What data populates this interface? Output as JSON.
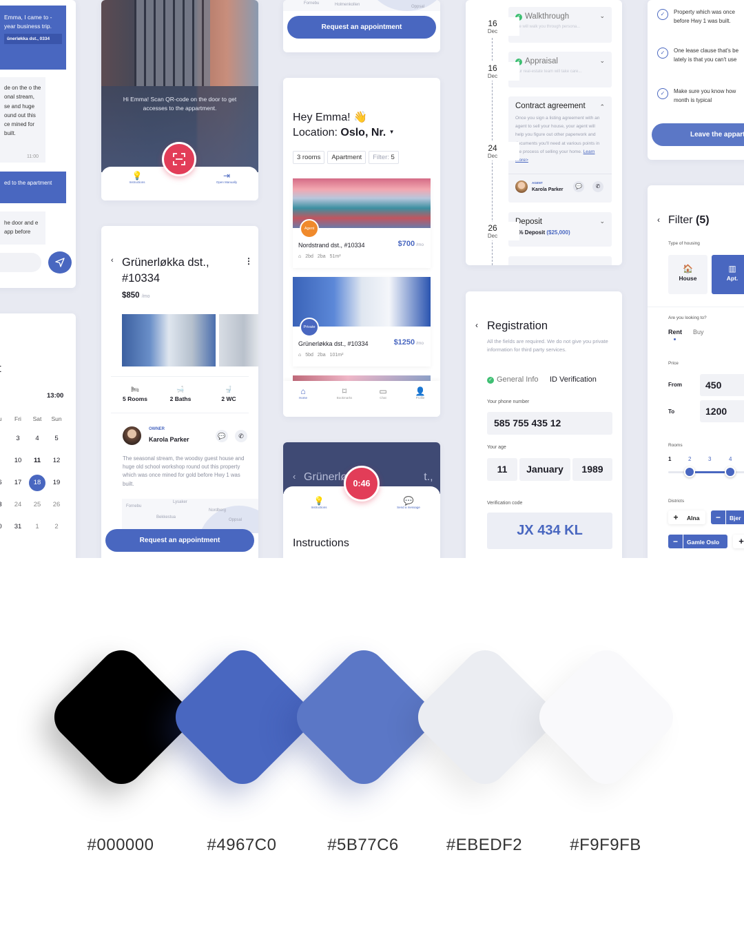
{
  "chat": {
    "msg1": "Emma, I came to -year business trip.",
    "msg1_sub": "ünerløkka dst., 0334",
    "msg2": "de on the o the onal stream, se and huge ound out this ce mined for built.",
    "msg2_time": "11:00",
    "msg3": "ed to the apartment",
    "msg4": "he door and e app before"
  },
  "calendar": {
    "title_fragment": "t",
    "time": "13:00",
    "weekdays": [
      "u",
      "Fri",
      "Sat",
      "Sun"
    ],
    "rows": [
      [
        "",
        "3",
        "4",
        "5"
      ],
      [
        "",
        "10",
        "11",
        "12"
      ],
      [
        "6",
        "17",
        "18",
        "19"
      ],
      [
        "3",
        "24",
        "25",
        "26"
      ],
      [
        "0",
        "31",
        "1",
        "2"
      ]
    ]
  },
  "door": {
    "scan_text": "Hi Emma! Scan QR-code on the door to get accesses to the appartment.",
    "nav_left": "Instructions",
    "nav_right": "Open Manually"
  },
  "listing": {
    "title": "Grünerløkka dst., #10334",
    "price": "$850",
    "per": "/mo",
    "features": [
      {
        "icon": "🛏",
        "label": "5 Rooms"
      },
      {
        "icon": "🛁",
        "label": "2 Baths"
      },
      {
        "icon": "🚽",
        "label": "2 WC"
      }
    ],
    "owner_role": "OWNER",
    "owner_name": "Karola Parker",
    "description": "The seasonal stream, the woodsy guest house and huge old school workshop round out this property which was once mined for gold before Hwy 1 was built.",
    "map_labels": [
      "Lysaker",
      "Bekkestua",
      "Nordberg",
      "Fornebu",
      "Holmenkollen",
      "Oppsal"
    ],
    "cta": "Request an appointment"
  },
  "top_mid": {
    "map_labels": [
      "Fornebu",
      "Holmenkollen",
      "Oppsal"
    ],
    "cta": "Request an appointment"
  },
  "search": {
    "greeting": "Hey Emma! 👋",
    "location_label": "Location:",
    "location_value": "Oslo, Nr.",
    "chips": [
      "3 rooms",
      "Apartment",
      "Filter:",
      "5"
    ],
    "items": [
      {
        "badge": "Agent",
        "name": "Nordstrand dst., #10334",
        "price": "$700",
        "per": "/mo",
        "specs": [
          "2bd",
          "2ba",
          "51m²"
        ]
      },
      {
        "badge": "Private",
        "name": "Grünerløkka dst., #10334",
        "price": "$1250",
        "per": "/mo",
        "specs": [
          "5bd",
          "2ba",
          "101m²"
        ]
      }
    ],
    "nav": [
      "Home",
      "Bookmarks",
      "Chat",
      "Profile"
    ]
  },
  "call": {
    "title_fragment": "Grünerlø                         t.,",
    "timer": "0:46",
    "nav_left": "Instructions",
    "nav_right": "Send a message",
    "heading": "Instructions"
  },
  "timeline": {
    "dates": [
      {
        "day": "16",
        "mon": "Dec"
      },
      {
        "day": "16",
        "mon": "Dec"
      },
      {
        "day": "24",
        "mon": "Dec"
      },
      {
        "day": "26",
        "mon": "Dec"
      }
    ],
    "walkthrough": {
      "title": "Walkthrough",
      "desc": "We will walk you through persona..."
    },
    "appraisal": {
      "title": "Appraisal",
      "desc": "Our real-estate team will take care..."
    },
    "contract": {
      "title": "Contract agreement",
      "desc": "Once you sign a listing agreement with an agent to sell your house, your agent will help you figure out other paperwork and documents you'll need at various points in the process of selling your home.",
      "link": "Learn more>",
      "agent_role": "AGENT",
      "agent_name": "Karola Parker"
    },
    "deposit": {
      "title": "Deposit",
      "value": "3% Deposit",
      "amount": "($25,000)"
    }
  },
  "registration": {
    "title": "Registration",
    "desc": "All the fields are required. We do not give you private information for third party services.",
    "tab_active": "General Info",
    "tab_other": "ID Verification",
    "phone_label": "Your phone number",
    "phone": "585 755 435 12",
    "age_label": "Your age",
    "day": "11",
    "month": "January",
    "year": "1989",
    "code_label": "Verification code",
    "code": "JX 434 KL"
  },
  "tips": {
    "items": [
      "Property which was once before Hwy 1 was built.",
      "One lease clause that's be lately is that you can't use",
      "Make sure you know how month is typical"
    ],
    "cta": "Leave the appart"
  },
  "filter": {
    "title": "Filter",
    "count": "(5)",
    "type_label": "Type of housing",
    "types": [
      "House",
      "Apt."
    ],
    "looking_label": "Are you looking to?",
    "looking": [
      "Rent",
      "Buy"
    ],
    "price_label": "Price",
    "from_label": "From",
    "from": "450",
    "to_label": "To",
    "to": "1200",
    "rooms_label": "Rooms",
    "rooms": [
      "1",
      "2",
      "3",
      "4"
    ],
    "rooms_range": [
      2,
      4
    ],
    "districts_label": "Districts",
    "districts": [
      {
        "label": "Alna",
        "selected": false
      },
      {
        "label": "Bjer",
        "selected": true
      },
      {
        "label": "Gamle Oslo",
        "selected": true
      }
    ]
  },
  "palette": [
    {
      "hex": "#000000",
      "color": "#000000"
    },
    {
      "hex": "#4967C0",
      "color": "#4967C0"
    },
    {
      "hex": "#5B77C6",
      "color": "#5B77C6"
    },
    {
      "hex": "#EBEDF2",
      "color": "#EBEDF2"
    },
    {
      "hex": "#F9F9FB",
      "color": "#F9F9FB"
    }
  ]
}
